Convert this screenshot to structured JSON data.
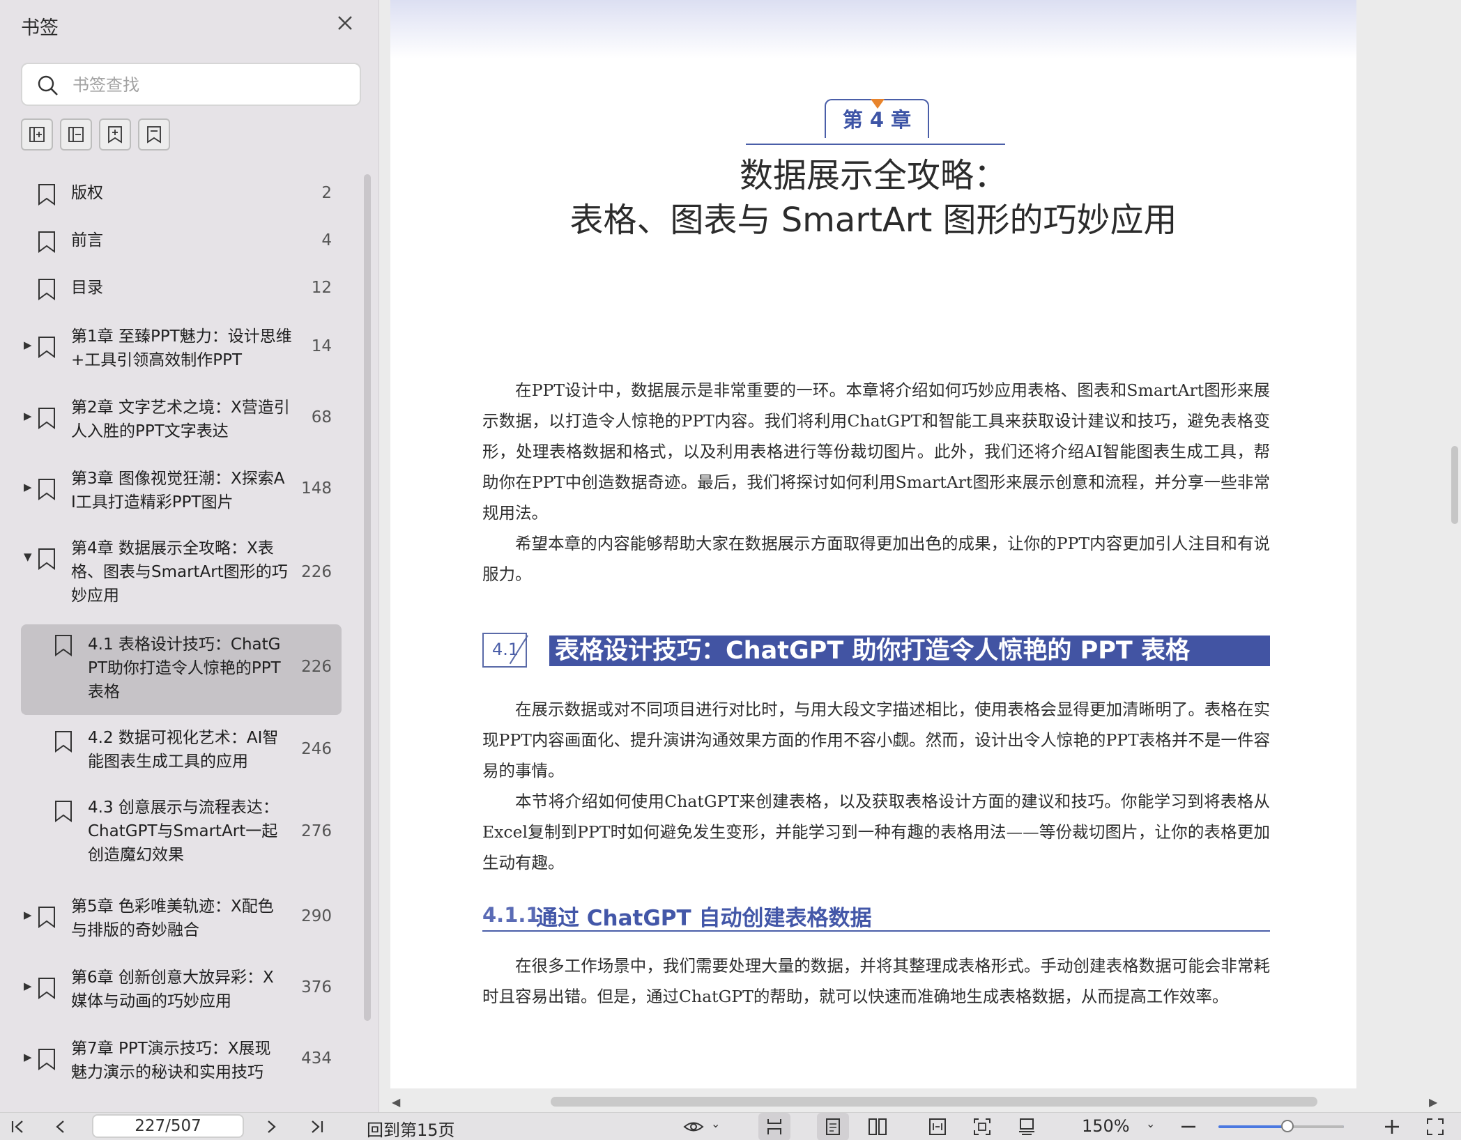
{
  "sidebar": {
    "title": "书签",
    "search_placeholder": "书签查找",
    "toolbar": [
      "expand-all",
      "collapse-all",
      "add-bookmark",
      "bookmark"
    ],
    "items": [
      {
        "label": "版权",
        "page": "2",
        "expandable": false,
        "indent": 0
      },
      {
        "label": "前言",
        "page": "4",
        "expandable": false,
        "indent": 0
      },
      {
        "label": "目录",
        "page": "12",
        "expandable": false,
        "indent": 0
      },
      {
        "label": "第1章 至臻PPT魅力：设计思维\n+工具引领高效制作PPT",
        "page": "14",
        "expandable": true,
        "expanded": false,
        "indent": 0
      },
      {
        "label": "第2章 文字艺术之境：X营造引\n人入胜的PPT文字表达",
        "page": "68",
        "expandable": true,
        "expanded": false,
        "indent": 0
      },
      {
        "label": "第3章 图像视觉狂潮：X探索A\nI工具打造精彩PPT图片",
        "page": "148",
        "expandable": true,
        "expanded": false,
        "indent": 0
      },
      {
        "label": "第4章 数据展示全攻略：X表\n格、图表与SmartArt图形的巧\n妙应用",
        "page": "226",
        "expandable": true,
        "expanded": true,
        "indent": 0
      },
      {
        "label": "4.1 表格设计技巧：ChatG\nPT助你打造令人惊艳的PPT\n表格",
        "page": "226",
        "expandable": false,
        "indent": 1,
        "active": true
      },
      {
        "label": "4.2 数据可视化艺术：AI智\n能图表生成工具的应用",
        "page": "246",
        "expandable": false,
        "indent": 1
      },
      {
        "label": "4.3 创意展示与流程表达：\nChatGPT与SmartArt一起\n创造魔幻效果",
        "page": "276",
        "expandable": false,
        "indent": 1
      },
      {
        "label": "第5章 色彩唯美轨迹：X配色\n与排版的奇妙融合",
        "page": "290",
        "expandable": true,
        "expanded": false,
        "indent": 0
      },
      {
        "label": "第6章 创新创意大放异彩：X\n媒体与动画的巧妙应用",
        "page": "376",
        "expandable": true,
        "expanded": false,
        "indent": 0
      },
      {
        "label": "第7章 PPT演示技巧：X展现\n魅力演示的秘诀和实用技巧",
        "page": "434",
        "expandable": true,
        "expanded": false,
        "indent": 0
      }
    ]
  },
  "document": {
    "chapter_tab": "第 4 章",
    "title_line1": "数据展示全攻略：",
    "title_line2": "表格、图表与 SmartArt 图形的巧妙应用",
    "intro_p1": "在PPT设计中，数据展示是非常重要的一环。本章将介绍如何巧妙应用表格、图表和SmartArt图形来展示数据，以打造令人惊艳的PPT内容。我们将利用ChatGPT和智能工具来获取设计建议和技巧，避免表格变形，处理表格数据和格式，以及利用表格进行等份裁切图片。此外，我们还将介绍AI智能图表生成工具，帮助你在PPT中创造数据奇迹。最后，我们将探讨如何利用SmartArt图形来展示创意和流程，并分享一些非常规用法。",
    "intro_p2": "希望本章的内容能够帮助大家在数据展示方面取得更加出色的成果，让你的PPT内容更加引人注目和有说服力。",
    "section_41_number": "4.1",
    "section_41_title": "表格设计技巧：ChatGPT 助你打造令人惊艳的 PPT 表格",
    "s41_p1": "在展示数据或对不同项目进行对比时，与用大段文字描述相比，使用表格会显得更加清晰明了。表格在实现PPT内容画面化、提升演讲沟通效果方面的作用不容小觑。然而，设计出令人惊艳的PPT表格并不是一件容易的事情。",
    "s41_p2": "本节将介绍如何使用ChatGPT来创建表格，以及获取表格设计方面的建议和技巧。你能学习到将表格从Excel复制到PPT时如何避免发生变形，并能学习到一种有趣的表格用法——等份裁切图片，让你的表格更加生动有趣。",
    "section_411_number": "4.1.1",
    "section_411_title": "通过 ChatGPT 自动创建表格数据",
    "s411_p1": "在很多工作场景中，我们需要处理大量的数据，并将其整理成表格形式。手动创建表格数据可能会非常耗时且容易出错。但是，通过ChatGPT的帮助，就可以快速而准确地生成表格数据，从而提高工作效率。"
  },
  "bottombar": {
    "page_indicator": "227/507",
    "back_link": "回到第15页",
    "zoom": "150%",
    "zoom_level": 0.55
  },
  "colors": {
    "accent_blue": "#4254a3",
    "chapter_triangle": "#e8842c",
    "sidebar_bg": "#e6e3e7",
    "active_item_bg": "#c6c3c7"
  }
}
